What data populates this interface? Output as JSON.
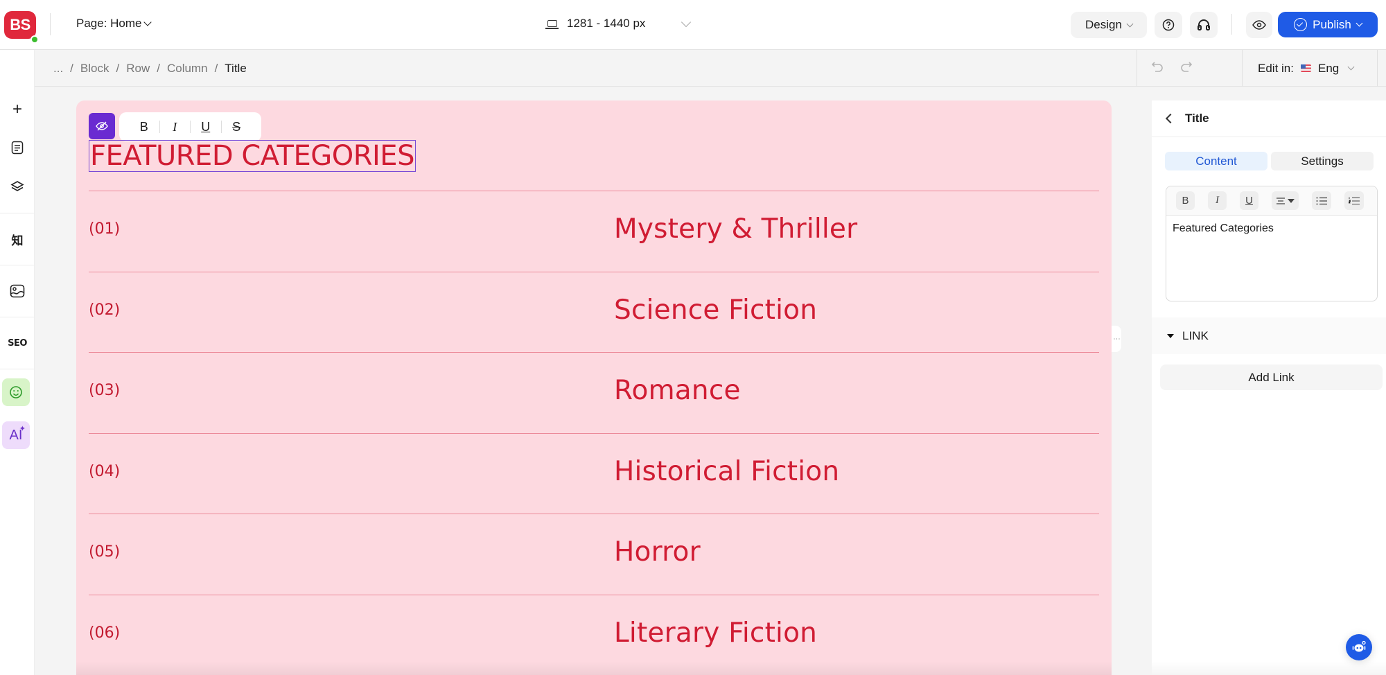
{
  "app": {
    "logo": "BS"
  },
  "topbar": {
    "page_label": "Page: Home",
    "viewport_range": "1281  - 1440 px",
    "design_label": "Design",
    "publish_label": "Publish"
  },
  "sidebar": {
    "items": [
      {
        "name": "add",
        "glyph": "+"
      },
      {
        "name": "pages",
        "glyph": ""
      },
      {
        "name": "layers",
        "glyph": ""
      },
      {
        "name": "knowledge",
        "glyph": "知"
      },
      {
        "name": "media",
        "glyph": ""
      },
      {
        "name": "seo",
        "glyph": "SEO"
      },
      {
        "name": "feedback",
        "glyph": ""
      },
      {
        "name": "ai",
        "glyph": "AI"
      }
    ]
  },
  "breadcrumb": {
    "items": [
      "...",
      "Block",
      "Row",
      "Column"
    ],
    "separator": "/",
    "current": "Title"
  },
  "language": {
    "label": "Edit in:",
    "value": "Eng"
  },
  "canvas": {
    "format_buttons": [
      "B",
      "I",
      "U",
      "S"
    ],
    "title": "FEATURED CATEGORIES",
    "categories": [
      {
        "number": "(01)",
        "name": "Mystery & Thriller"
      },
      {
        "number": "(02)",
        "name": "Science Fiction"
      },
      {
        "number": "(03)",
        "name": "Romance"
      },
      {
        "number": "(04)",
        "name": "Historical Fiction"
      },
      {
        "number": "(05)",
        "name": "Horror"
      },
      {
        "number": "(06)",
        "name": "Literary Fiction"
      }
    ],
    "colors": {
      "background": "#fdd9e0",
      "text": "#d01c33",
      "divider": "#ec8a9a"
    }
  },
  "panel": {
    "title": "Title",
    "tabs": [
      {
        "label": "Content",
        "active": true
      },
      {
        "label": "Settings",
        "active": false
      }
    ],
    "editor_tools": [
      "B",
      "I",
      "U",
      "align",
      "bullet-list",
      "numbered-list"
    ],
    "editor_text": "Featured Categories",
    "link_section_label": "LINK",
    "add_link_label": "Add Link"
  },
  "colors": {
    "accent": "#1f5be6",
    "brand": "#e0283c",
    "selection": "#6a2bd1"
  }
}
